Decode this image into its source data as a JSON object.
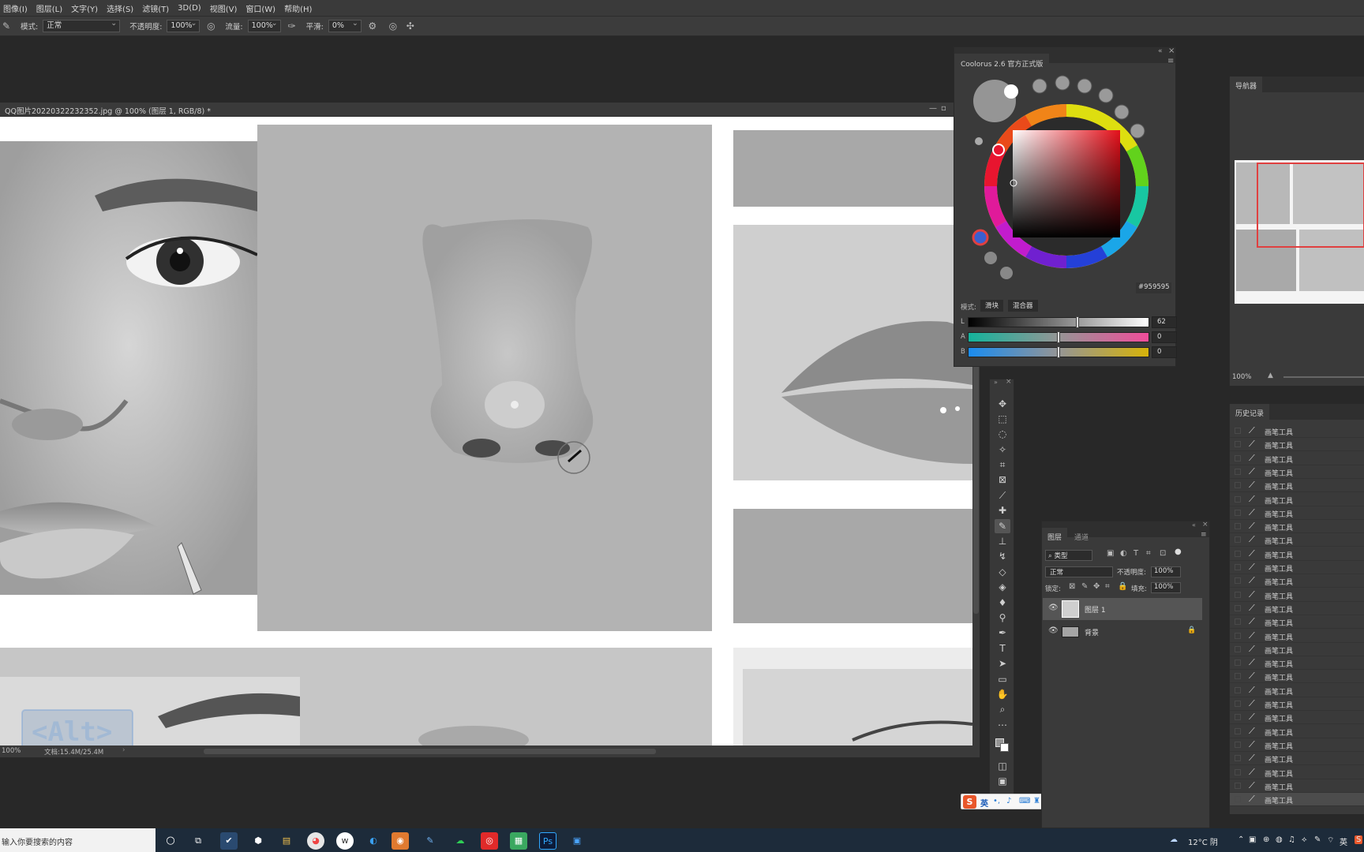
{
  "menu": [
    "图像(I)",
    "图层(L)",
    "文字(Y)",
    "选择(S)",
    "滤镜(T)",
    "3D(D)",
    "视图(V)",
    "窗口(W)",
    "帮助(H)"
  ],
  "options": {
    "mode_label": "模式:",
    "mode_value": "正常",
    "opacity_label": "不透明度:",
    "opacity_value": "100%",
    "flow_label": "流量:",
    "flow_value": "100%",
    "smooth_label": "平滑:",
    "smooth_value": "0%"
  },
  "document": {
    "title": "QQ图片20220322232352.jpg @ 100% (图层 1, RGB/8) *",
    "zoom": "100%",
    "file_info": "文档:15.4M/25.4M",
    "alt_hint": "<Alt>"
  },
  "coolorus": {
    "tab": "Coolorus 2.6 官方正式版",
    "hex": "959595",
    "hex_prefix": "#",
    "mode_label": "模式:",
    "btn_slider": "滑块",
    "btn_mixer": "混合器",
    "sliders": [
      {
        "label": "L",
        "value": "62",
        "pos": 0.62
      },
      {
        "label": "A",
        "value": "0",
        "pos": 0.5
      },
      {
        "label": "B",
        "value": "0",
        "pos": 0.5
      }
    ],
    "current_color": "#959595"
  },
  "navigator": {
    "tab": "导航器",
    "zoom": "100%"
  },
  "layers": {
    "tab_layers": "图层",
    "tab_channels": "通道",
    "filter_kind": "类型",
    "blend_mode": "正常",
    "opacity_label": "不透明度:",
    "opacity_value": "100%",
    "lock_label": "锁定:",
    "fill_label": "填充:",
    "fill_value": "100%",
    "items": [
      {
        "name": "图层 1"
      },
      {
        "name": "背景"
      }
    ]
  },
  "history": {
    "tab": "历史记录",
    "item_label": "画笔工具",
    "count": 28
  },
  "taskbar": {
    "search_placeholder": "输入你要搜索的内容",
    "weather": "12°C 阴",
    "ime_lang": "英"
  },
  "ime": {
    "logo": "S",
    "lang": "英"
  }
}
